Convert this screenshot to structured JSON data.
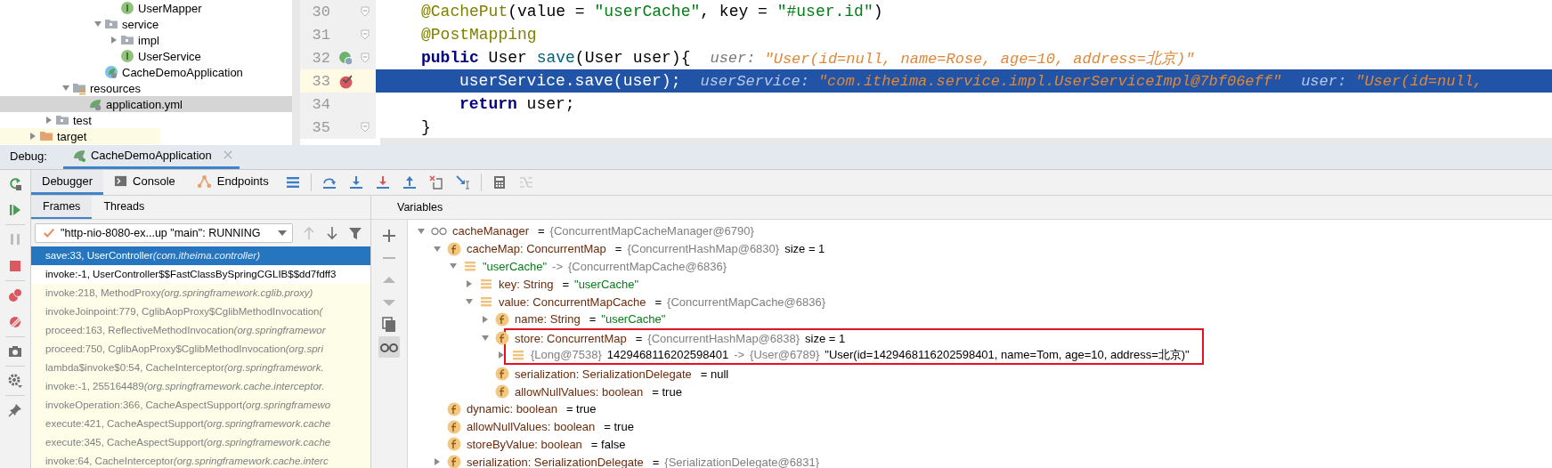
{
  "project_tree": [
    {
      "label": "UserMapper",
      "kind": "interface",
      "selected": false
    },
    {
      "label": "service",
      "kind": "folder",
      "expanded": true,
      "selected": false,
      "children": [
        {
          "label": "impl",
          "kind": "folder",
          "expanded": false,
          "selected": false
        },
        {
          "label": "UserService",
          "kind": "interface",
          "selected": false
        }
      ]
    },
    {
      "label": "CacheDemoApplication",
      "kind": "spring_app",
      "selected": false
    },
    {
      "label": "resources",
      "kind": "resources",
      "expanded": true,
      "selected": false,
      "children": [
        {
          "label": "application.yml",
          "kind": "yml",
          "selected": true
        }
      ]
    },
    {
      "label": "test",
      "kind": "folder",
      "expanded": false,
      "selected": false
    },
    {
      "label": "target",
      "kind": "excluded",
      "expanded": false,
      "selected": false
    }
  ],
  "editor": {
    "lines": [
      {
        "number": "30",
        "kind": "plain",
        "fold": true,
        "current": false,
        "body": false,
        "tokens": [
          {
            "kind": "annotation",
            "text": "@CachePut"
          },
          {
            "kind": "plain",
            "text": "(value = "
          },
          {
            "kind": "string",
            "text": "\"userCache\""
          },
          {
            "kind": "plain",
            "text": ", key = "
          },
          {
            "kind": "string",
            "text": "\"#user.id\""
          },
          {
            "kind": "plain",
            "text": ")"
          }
        ]
      },
      {
        "number": "31",
        "kind": "plain",
        "fold": true,
        "current": false,
        "body": false,
        "tokens": [
          {
            "kind": "annotation",
            "text": "@PostMapping"
          }
        ]
      },
      {
        "number": "32",
        "kind": "endpoint",
        "fold": true,
        "current": false,
        "body": false,
        "tokens": [
          {
            "kind": "keyword",
            "text": "public"
          },
          {
            "kind": "plain",
            "text": " User "
          },
          {
            "kind": "method",
            "text": "save"
          },
          {
            "kind": "plain",
            "text": "(User user){"
          },
          {
            "kind": "hint",
            "text": "user:"
          },
          {
            "kind": "hint_value",
            "text": "\"User(id=null, name=Rose, age=10, address=北京)\""
          }
        ]
      },
      {
        "number": "33",
        "kind": "breakpoint",
        "fold": false,
        "current": true,
        "body": true,
        "tokens": [
          {
            "kind": "plain",
            "text": "userService.save(user);"
          },
          {
            "kind": "hint",
            "text": "userService:"
          },
          {
            "kind": "hint_value",
            "text": "\"com.itheima.service.impl.UserServiceImpl@7bf06eff\""
          },
          {
            "kind": "hint",
            "text": "user:"
          },
          {
            "kind": "hint_value",
            "text": "\"User(id=null,"
          }
        ]
      },
      {
        "number": "34",
        "kind": "plain",
        "fold": false,
        "current": false,
        "body": true,
        "tokens": [
          {
            "kind": "keyword",
            "text": "return"
          },
          {
            "kind": "plain",
            "text": " user;"
          }
        ]
      },
      {
        "number": "35",
        "kind": "plain",
        "fold": true,
        "current": false,
        "body": false,
        "tokens": [
          {
            "kind": "plain",
            "text": "}"
          }
        ]
      }
    ]
  },
  "debug": {
    "label": "Debug:",
    "tabs": [
      {
        "label": "CacheDemoApplication",
        "selected": true
      }
    ]
  },
  "left_toolbar": [
    {
      "kind": "rerun",
      "disabled": false
    },
    {
      "kind": "resume",
      "disabled": false
    },
    {
      "kind": "pause",
      "disabled": true
    },
    {
      "kind": "stop",
      "disabled": false
    },
    {
      "kind": "breakpoints",
      "disabled": false
    },
    {
      "kind": "mute",
      "disabled": false
    },
    {
      "kind": "snapshot",
      "disabled": false
    },
    {
      "kind": "settings",
      "disabled": false
    },
    {
      "kind": "pin",
      "disabled": false
    }
  ],
  "toolbar": {
    "tabs": [
      {
        "label": "Debugger",
        "kind": "debugger",
        "selected": true
      },
      {
        "label": "Console",
        "kind": "console",
        "selected": false
      },
      {
        "label": "Endpoints",
        "kind": "endpoints",
        "selected": false
      }
    ],
    "actions": [
      {
        "kind": "layout",
        "disabled": false
      },
      {
        "kind": "step_over",
        "disabled": false
      },
      {
        "kind": "step_into",
        "disabled": false
      },
      {
        "kind": "force_step_into",
        "disabled": false
      },
      {
        "kind": "step_out",
        "disabled": false
      },
      {
        "kind": "drop_frame",
        "disabled": false
      },
      {
        "kind": "run_to_cursor",
        "disabled": false
      },
      {
        "kind": "evaluate",
        "disabled": false
      },
      {
        "kind": "trace",
        "disabled": true
      }
    ]
  },
  "frames": {
    "tabs": [
      {
        "label": "Frames",
        "selected": true
      },
      {
        "label": "Threads",
        "selected": false
      }
    ],
    "thread_selector": {
      "value": "\"http-nio-8080-ex...up \"main\": RUNNING"
    },
    "nav": [
      {
        "kind": "up",
        "disabled": true
      },
      {
        "kind": "down",
        "disabled": false
      },
      {
        "kind": "filter",
        "disabled": false
      }
    ],
    "list": [
      {
        "method": "save:33, UserController",
        "package": "(com.itheima.controller)",
        "selected": true,
        "library": false
      },
      {
        "method": "invoke:-1, UserController$$FastClassBySpringCGLIB$$dd7fdff3",
        "selected": false,
        "library": false
      },
      {
        "method": "invoke:218, MethodProxy",
        "package": "(org.springframework.cglib.proxy)",
        "selected": false,
        "library": true
      },
      {
        "method": "invokeJoinpoint:779, CglibAopProxy$CglibMethodInvocation",
        "package": "(",
        "selected": false,
        "library": true
      },
      {
        "method": "proceed:163, ReflectiveMethodInvocation",
        "package": "(org.springframewor",
        "selected": false,
        "library": true
      },
      {
        "method": "proceed:750, CglibAopProxy$CglibMethodInvocation",
        "package": "(org.spri",
        "selected": false,
        "library": true
      },
      {
        "method": "lambda$invoke$0:54, CacheInterceptor",
        "package": "(org.springframework.",
        "selected": false,
        "library": true
      },
      {
        "method": "invoke:-1, 255164489",
        "package": "(org.springframework.cache.interceptor.",
        "selected": false,
        "library": true
      },
      {
        "method": "invokeOperation:366, CacheAspectSupport",
        "package": "(org.springframewo",
        "selected": false,
        "library": true
      },
      {
        "method": "execute:421, CacheAspectSupport",
        "package": "(org.springframework.cache",
        "selected": false,
        "library": true
      },
      {
        "method": "execute:345, CacheAspectSupport",
        "package": "(org.springframework.cache",
        "selected": false,
        "library": true
      },
      {
        "method": "invoke:64, CacheInterceptor",
        "package": "(org.springframework.cache.interc",
        "selected": false,
        "library": true
      }
    ]
  },
  "variables": {
    "title": "Variables",
    "side_toolbar": [
      {
        "kind": "add",
        "disabled": false,
        "on": false
      },
      {
        "kind": "remove",
        "disabled": true,
        "on": false
      },
      {
        "kind": "up",
        "disabled": true,
        "on": false
      },
      {
        "kind": "down",
        "disabled": true,
        "on": false
      },
      {
        "kind": "copy",
        "disabled": false,
        "on": false
      },
      {
        "kind": "watches",
        "disabled": false,
        "on": true
      }
    ],
    "tree": [
      {
        "kind": "watch",
        "label": "cacheManager",
        "value": [
          {
            "kind": "plain",
            "text": "="
          },
          {
            "kind": "ref",
            "text": "{ConcurrentMapCacheManager@6790}"
          }
        ],
        "expanded": true,
        "highlighted": false,
        "children": [
          {
            "kind": "field",
            "label": "cacheMap: ConcurrentMap",
            "value": [
              {
                "kind": "plain",
                "text": "="
              },
              {
                "kind": "ref",
                "text": "{ConcurrentHashMap@6830}"
              },
              {
                "kind": "plain",
                "text": "size = 1"
              }
            ],
            "expanded": true,
            "highlighted": false,
            "children": [
              {
                "kind": "entry",
                "value": [
                  {
                    "kind": "string",
                    "text": "\"userCache\""
                  },
                  {
                    "kind": "ref",
                    "text": "->"
                  },
                  {
                    "kind": "ref",
                    "text": "{ConcurrentMapCache@6836}"
                  }
                ],
                "expanded": true,
                "highlighted": false,
                "children": [
                  {
                    "kind": "entry",
                    "label": "key: String",
                    "value": [
                      {
                        "kind": "plain",
                        "text": "="
                      },
                      {
                        "kind": "string",
                        "text": "\"userCache\""
                      }
                    ],
                    "expanded": false,
                    "highlighted": false
                  },
                  {
                    "kind": "entry",
                    "label": "value: ConcurrentMapCache",
                    "value": [
                      {
                        "kind": "plain",
                        "text": "="
                      },
                      {
                        "kind": "ref",
                        "text": "{ConcurrentMapCache@6836}"
                      }
                    ],
                    "expanded": true,
                    "highlighted": false,
                    "children": [
                      {
                        "kind": "field",
                        "label": "name: String",
                        "value": [
                          {
                            "kind": "plain",
                            "text": "="
                          },
                          {
                            "kind": "string",
                            "text": "\"userCache\""
                          }
                        ],
                        "expanded": false,
                        "highlighted": false
                      },
                      {
                        "kind": "field",
                        "label": "store: ConcurrentMap",
                        "value": [
                          {
                            "kind": "plain",
                            "text": "="
                          },
                          {
                            "kind": "ref",
                            "text": "{ConcurrentHashMap@6838}"
                          },
                          {
                            "kind": "plain",
                            "text": "size = 1"
                          }
                        ],
                        "expanded": true,
                        "highlighted": true,
                        "children": [
                          {
                            "kind": "entry",
                            "value": [
                              {
                                "kind": "ref",
                                "text": "{Long@7538}"
                              },
                              {
                                "kind": "plain",
                                "text": "1429468116202598401"
                              },
                              {
                                "kind": "ref",
                                "text": "->"
                              },
                              {
                                "kind": "ref",
                                "text": "{User@6789}"
                              },
                              {
                                "kind": "plain",
                                "text": "\"User(id=1429468116202598401, name=Tom, age=10, address=北京)\""
                              }
                            ],
                            "expanded": false,
                            "highlighted": false
                          }
                        ]
                      },
                      {
                        "kind": "field",
                        "label": "serialization: SerializationDelegate",
                        "value": [
                          {
                            "kind": "plain",
                            "text": "= null"
                          }
                        ],
                        "highlighted": false
                      },
                      {
                        "kind": "field",
                        "label": "allowNullValues: boolean",
                        "value": [
                          {
                            "kind": "plain",
                            "text": "= true"
                          }
                        ],
                        "highlighted": false
                      }
                    ]
                  }
                ]
              }
            ]
          },
          {
            "kind": "field",
            "label": "dynamic: boolean",
            "value": [
              {
                "kind": "plain",
                "text": "= true"
              }
            ],
            "highlighted": false
          },
          {
            "kind": "field",
            "label": "allowNullValues: boolean",
            "value": [
              {
                "kind": "plain",
                "text": "= true"
              }
            ],
            "highlighted": false
          },
          {
            "kind": "field",
            "label": "storeByValue: boolean",
            "value": [
              {
                "kind": "plain",
                "text": "= false"
              }
            ],
            "highlighted": false
          },
          {
            "kind": "field",
            "label": "serialization: SerializationDelegate",
            "value": [
              {
                "kind": "plain",
                "text": "="
              },
              {
                "kind": "ref",
                "text": "{SerializationDelegate@6831}"
              }
            ],
            "expanded": false,
            "highlighted": false
          }
        ]
      }
    ]
  }
}
